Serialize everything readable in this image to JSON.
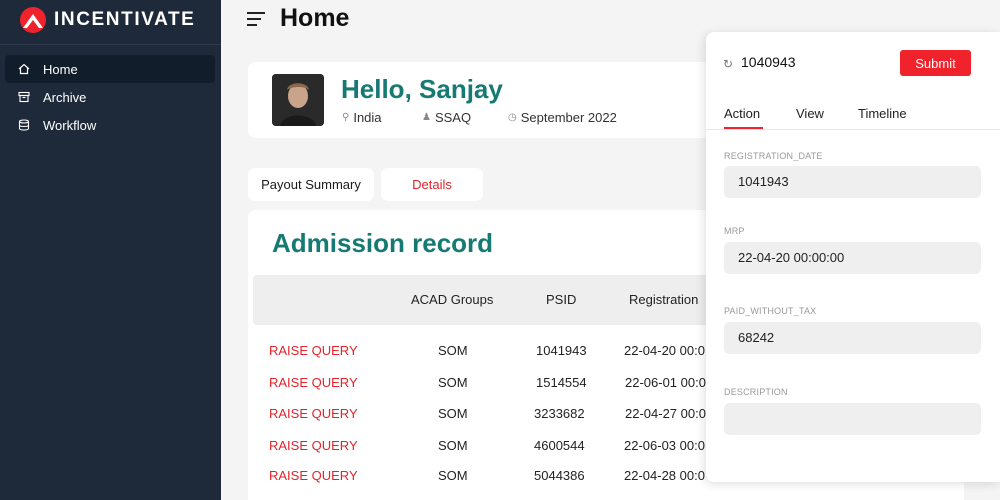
{
  "brand": {
    "name": "INCENTIVATE"
  },
  "sidebar": {
    "items": [
      {
        "label": "Home",
        "icon": "home-icon"
      },
      {
        "label": "Archive",
        "icon": "archive-icon"
      },
      {
        "label": "Workflow",
        "icon": "database-icon"
      }
    ]
  },
  "header": {
    "title": "Home"
  },
  "profile": {
    "greeting": "Hello, Sanjay",
    "location": "India",
    "role": "SSAQ",
    "period": "September 2022"
  },
  "tabs": [
    {
      "label": "Payout Summary"
    },
    {
      "label": "Details",
      "color": "#e0242b"
    }
  ],
  "main": {
    "section_title": "Admission record",
    "columns": [
      "ACAD Groups",
      "PSID",
      "Registration"
    ],
    "rows": [
      {
        "action": "RAISE QUERY",
        "group": "SOM",
        "psid": "1041943",
        "registration": "22-04-20 00:0"
      },
      {
        "action": "RAISE QUERY",
        "group": "SOM",
        "psid": "1514554",
        "registration": "22-06-01 00:0"
      },
      {
        "action": "RAISE QUERY",
        "group": "SOM",
        "psid": "3233682",
        "registration": "22-04-27 00:0"
      },
      {
        "action": "RAISE QUERY",
        "group": "SOM",
        "psid": "4600544",
        "registration": "22-06-03 00:0"
      },
      {
        "action": "RAISE QUERY",
        "group": "SOM",
        "psid": "5044386",
        "registration": "22-04-28 00:0"
      }
    ]
  },
  "panel": {
    "record_id": "1040943",
    "submit_label": "Submit",
    "tabs": [
      "Action",
      "View",
      "Timeline"
    ],
    "fields": [
      {
        "label": "REGISTRATION_DATE",
        "value": "1041943"
      },
      {
        "label": "MRP",
        "value": "22-04-20 00:00:00"
      },
      {
        "label": "PAID_WITHOUT_TAX",
        "value": "68242"
      },
      {
        "label": "DESCRIPTION",
        "value": ""
      }
    ]
  },
  "colors": {
    "accent": "#167a73",
    "danger": "#f0232d",
    "sidebar": "#1e2a3a"
  }
}
